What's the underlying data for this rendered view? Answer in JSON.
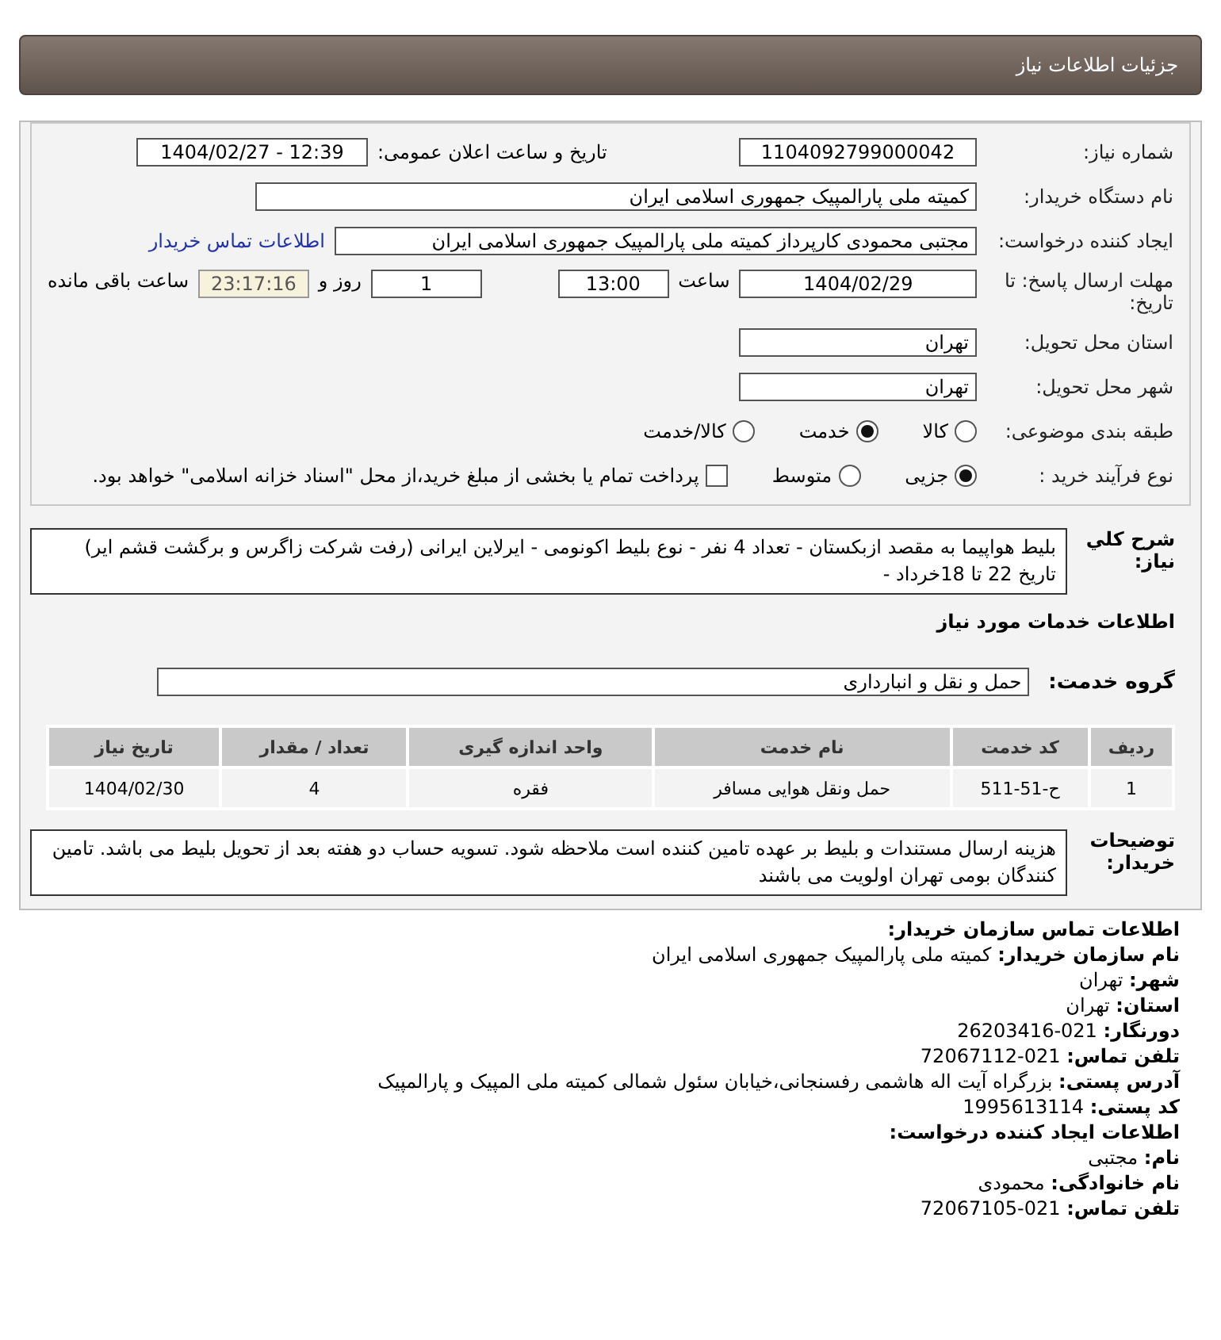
{
  "header": {
    "title": "جزئیات اطلاعات نیاز"
  },
  "form": {
    "need_number": {
      "label": "شماره نیاز:",
      "value": "1104092799000042"
    },
    "announce": {
      "label": "تاریخ و ساعت اعلان عمومی:",
      "value": "1404/02/27 - 12:39"
    },
    "buyer_org": {
      "label": "نام دستگاه خریدار:",
      "value": "کمیته ملی پارالمپیک جمهوری اسلامی ایران"
    },
    "requester": {
      "label": "ایجاد کننده درخواست:",
      "value": "مجتبی محمودی کارپرداز کمیته ملی پارالمپیک جمهوری اسلامی ایران",
      "link": "اطلاعات تماس خریدار"
    },
    "deadline": {
      "label": "مهلت ارسال پاسخ: تا تاریخ:",
      "date": "1404/02/29",
      "time_label": "ساعت",
      "time": "13:00",
      "days": "1",
      "days_label": "روز و",
      "remaining": "23:17:16",
      "remaining_label": "ساعت باقی مانده"
    },
    "province": {
      "label": "استان محل تحویل:",
      "value": "تهران"
    },
    "city": {
      "label": "شهر محل تحویل:",
      "value": "تهران"
    },
    "category": {
      "label": "طبقه بندی موضوعی:",
      "options": [
        {
          "label": "کالا",
          "selected": false
        },
        {
          "label": "خدمت",
          "selected": true
        },
        {
          "label": "کالا/خدمت",
          "selected": false
        }
      ]
    },
    "process": {
      "label": "نوع فرآیند خرید :",
      "options": [
        {
          "label": "جزیی",
          "selected": true
        },
        {
          "label": "متوسط",
          "selected": false
        }
      ],
      "payment": {
        "label": "پرداخت تمام یا بخشی از مبلغ خرید،از محل \"اسناد خزانه اسلامی\" خواهد بود.",
        "checked": false
      }
    }
  },
  "description": {
    "label": "شرح کلي نیاز:",
    "text": "بلیط هواپیما به مقصد ازبکستان - تعداد 4 نفر - نوع بلیط اکونومی - ایرلاین ایرانی (رفت شرکت زاگرس و برگشت قشم ایر) تاریخ 22 تا 18خرداد -"
  },
  "services": {
    "title": "اطلاعات خدمات مورد نیاز",
    "group_label": "گروه خدمت:",
    "group_value": "حمل و نقل و انبارداری"
  },
  "table": {
    "columns": [
      "ردیف",
      "کد خدمت",
      "نام خدمت",
      "واحد اندازه گیری",
      "تعداد / مقدار",
      "تاریخ نیاز"
    ],
    "rows": [
      [
        "1",
        "ح-51-511",
        "حمل ونقل هوایی مسافر",
        "فقره",
        "4",
        "1404/02/30"
      ]
    ]
  },
  "notes": {
    "label": "توضیحات خریدار:",
    "text": "هزینه ارسال مستندات و بلیط بر عهده تامین کننده است ملاحظه شود. تسویه حساب دو هفته بعد از تحویل بلیط می باشد. تامین کنندگان بومی تهران اولویت می باشند"
  },
  "contact": {
    "title": "اطلاعات تماس سازمان خریدار:",
    "lines": [
      {
        "label": "نام سازمان خریدار:",
        "value": "کمیته ملی پارالمپیک جمهوری اسلامی ایران"
      },
      {
        "label": "شهر:",
        "value": "تهران"
      },
      {
        "label": "استان:",
        "value": "تهران"
      },
      {
        "label": "دورنگار:",
        "value": "26203416-021"
      },
      {
        "label": "تلفن تماس:",
        "value": "72067112-021"
      },
      {
        "label": "آدرس پستی:",
        "value": "بزرگراه آیت اله هاشمی رفسنجانی،خیابان سئول شمالی کمیته ملی المپیک و پارالمپیک"
      },
      {
        "label": "کد پستی:",
        "value": "1995613114"
      }
    ]
  },
  "creator": {
    "title": "اطلاعات ایجاد کننده درخواست:",
    "lines": [
      {
        "label": "نام:",
        "value": "مجتبی"
      },
      {
        "label": "نام خانوادگی:",
        "value": "محمودی"
      },
      {
        "label": "تلفن تماس:",
        "value": "72067105-021"
      }
    ]
  }
}
